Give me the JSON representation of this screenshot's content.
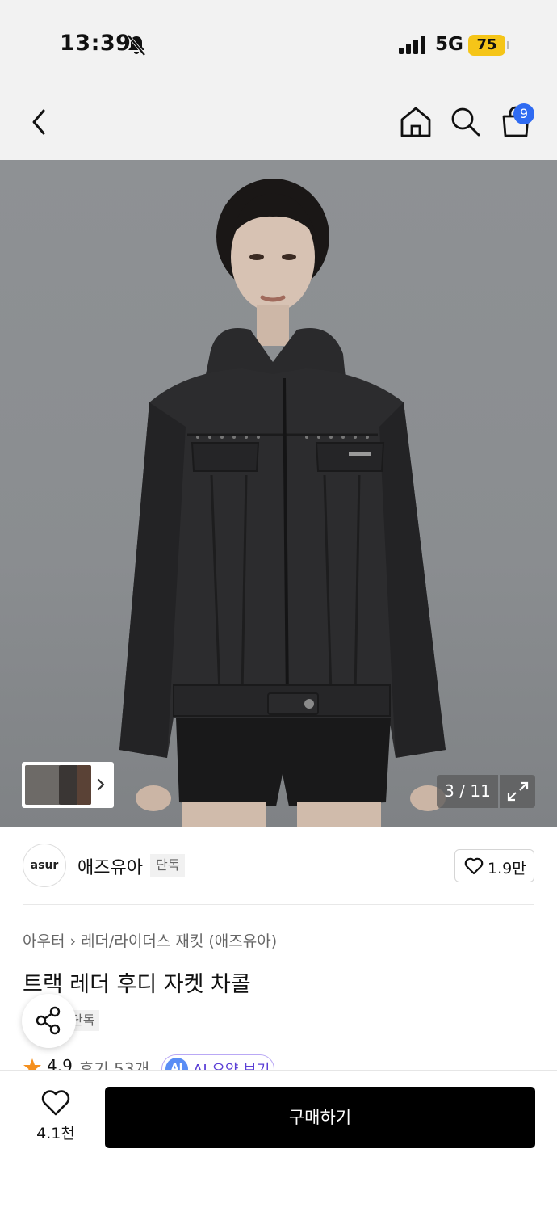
{
  "status_bar": {
    "time": "13:39",
    "network": "5G",
    "battery": "75"
  },
  "header": {
    "cart_count": "9",
    "icons": [
      "back-icon",
      "home-icon",
      "search-icon",
      "shopping-bag-icon"
    ]
  },
  "gallery": {
    "counter": "3 / 11",
    "icons": [
      "expand-icon",
      "chevron-right-icon"
    ]
  },
  "brand": {
    "logo_text": "asur",
    "name": "애즈유아",
    "tag": "단독",
    "likes": "1.9만"
  },
  "product": {
    "breadcrumb": [
      "아우터",
      "레더/라이더스 재킷 (애즈유아)"
    ],
    "title": "트랙 레더 후디 자켓 차콜",
    "exclusive_tag": "단독",
    "rating": "4.9",
    "reviews": "후기 53개",
    "ai_icon": "AI",
    "ai_label": "AI 요약 보기"
  },
  "bottom_bar": {
    "wish_count": "4.1천",
    "buy_label": "구매하기"
  },
  "colors": {
    "accent_blue": "#2f6bf2",
    "battery_yellow": "#f5c518",
    "star_orange": "#f5901e",
    "ai_purple": "#5b3fd6"
  }
}
